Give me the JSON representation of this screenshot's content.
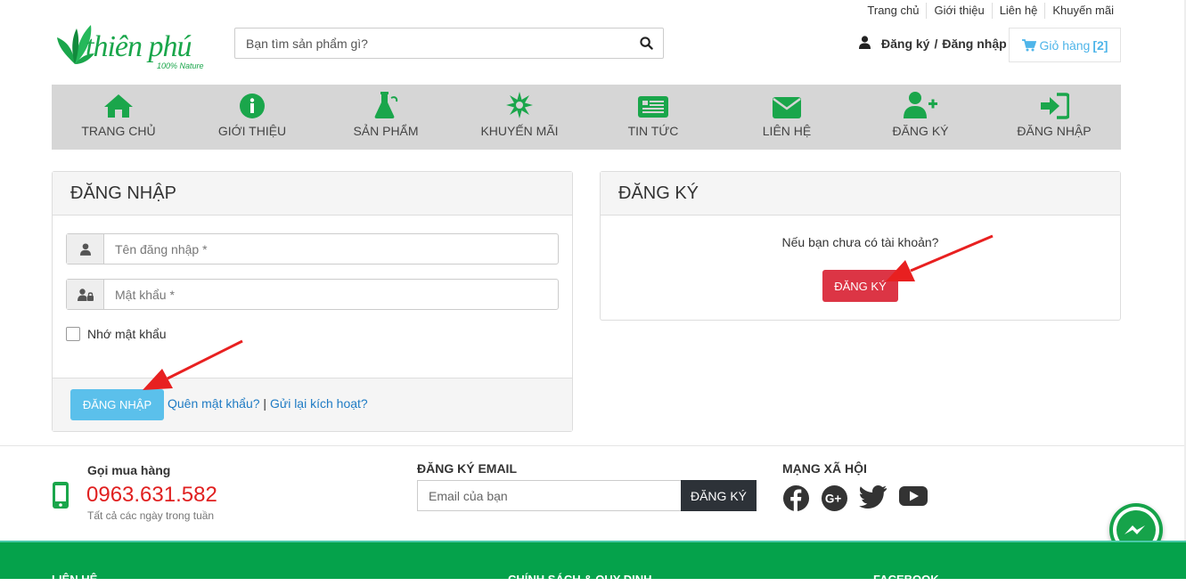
{
  "top_links": [
    "Trang chủ",
    "Giới thiệu",
    "Liên hệ",
    "Khuyến mãi"
  ],
  "logo": {
    "brand": "thiên phú",
    "tagline": "100% Nature"
  },
  "search": {
    "placeholder": "Bạn tìm sản phẩm gì?"
  },
  "account": {
    "register_label": "Đăng ký",
    "separator": "/",
    "login_label": "Đăng nhập"
  },
  "cart": {
    "label": "Giỏ hàng",
    "count": "[2]"
  },
  "nav": [
    {
      "label": "TRANG CHỦ",
      "icon": "home-icon"
    },
    {
      "label": "GIỚI THIỆU",
      "icon": "info-icon"
    },
    {
      "label": "SẢN PHẨM",
      "icon": "flask-icon"
    },
    {
      "label": "KHUYẾN MÃI",
      "icon": "burst-icon"
    },
    {
      "label": "TIN TỨC",
      "icon": "newspaper-icon"
    },
    {
      "label": "LIÊN HỆ",
      "icon": "envelope-icon"
    },
    {
      "label": "ĐĂNG KÝ",
      "icon": "user-plus-icon"
    },
    {
      "label": "ĐĂNG NHẬP",
      "icon": "sign-in-icon"
    }
  ],
  "login_panel": {
    "title": "ĐĂNG NHẬP",
    "username_placeholder": "Tên đăng nhập *",
    "password_placeholder": "Mật khẩu *",
    "remember_label": "Nhớ mật khẩu",
    "submit_label": "ĐĂNG NHẬP",
    "forgot_label": "Quên mật khẩu?",
    "link_separator": "|",
    "resend_label": "Gửi lại kích hoạt?"
  },
  "register_panel": {
    "title": "ĐĂNG KÝ",
    "prompt": "Nếu bạn chưa có tài khoản?",
    "button_label": "ĐĂNG KÝ"
  },
  "footer": {
    "hotline_label": "Gọi mua hàng",
    "hotline_number": "0963.631.582",
    "hotline_note": "Tất cả các ngày trong tuần",
    "newsletter_label": "ĐĂNG KÝ EMAIL",
    "newsletter_placeholder": "Email của bạn",
    "newsletter_button": "ĐĂNG KÝ",
    "social_label": "MẠNG XÃ HỘI",
    "bar_columns": [
      "LIÊN HỆ",
      "CHÍNH SÁCH & QUY ĐỊNH",
      "FACEBOOK"
    ]
  },
  "colors": {
    "brand_green": "#1aa64b",
    "nav_bg": "#d6d6d6",
    "login_button": "#5bc0eb",
    "register_button": "#dc3545",
    "link": "#1e7bc4",
    "hotline": "#e02020",
    "annotation_arrow": "#e82020"
  }
}
